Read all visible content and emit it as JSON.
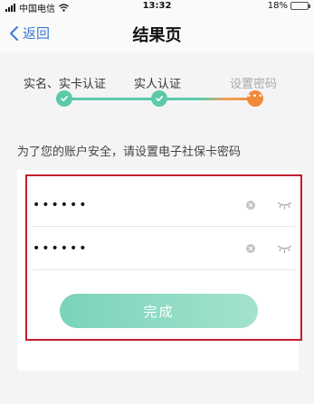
{
  "status_bar": {
    "carrier": "中国电信",
    "time": "13:32",
    "battery": "18%",
    "battery_level": 0.18
  },
  "nav": {
    "back_label": "返回",
    "title": "结果页"
  },
  "steps": [
    {
      "label": "实名、实卡认证",
      "state": "done"
    },
    {
      "label": "实人认证",
      "state": "done"
    },
    {
      "label": "设置密码",
      "state": "current",
      "marker": "•••"
    }
  ],
  "hint": "为了您的账户安全，请设置电子社保卡密码",
  "form": {
    "password_value": "••••••",
    "confirm_value": "••••••"
  },
  "submit_label": "完成",
  "colors": {
    "accent_blue": "#3b7ad8",
    "step_green": "#5cc9a7",
    "step_orange": "#f08a3a",
    "highlight_red": "#c51e2c"
  },
  "icons": [
    "signal-icon",
    "wifi-icon",
    "battery-icon",
    "back-chevron-icon",
    "check-icon",
    "clear-icon",
    "eye-closed-icon"
  ]
}
